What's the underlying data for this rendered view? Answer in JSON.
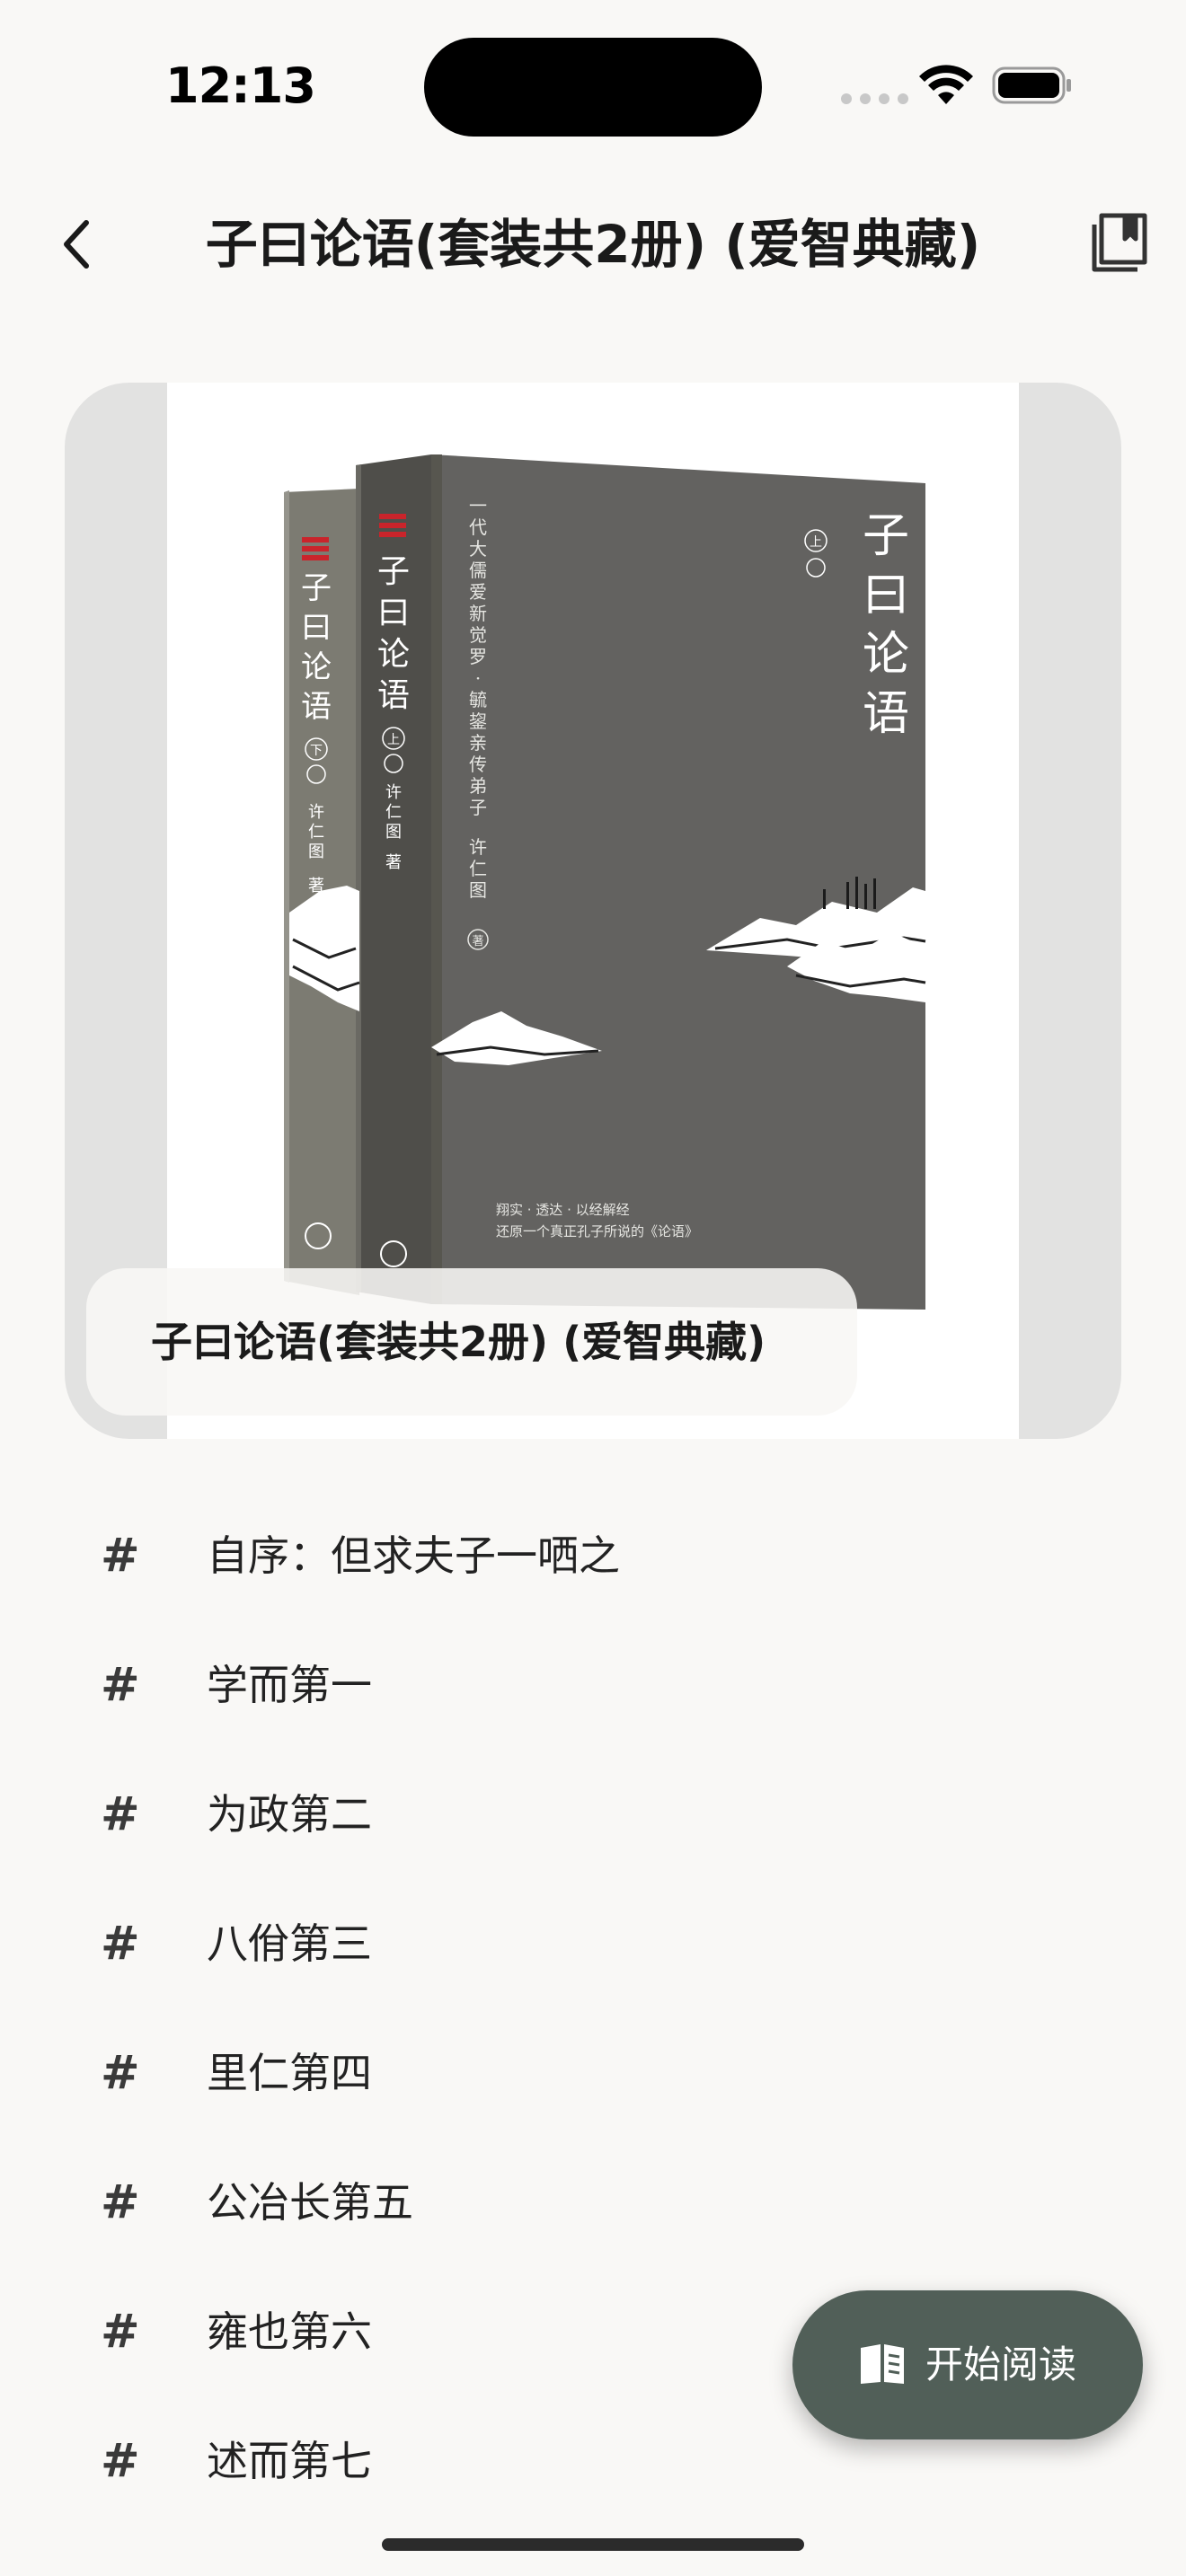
{
  "status_bar": {
    "time": "12:13"
  },
  "header": {
    "title": "子曰论语(套装共2册) (爱智典藏)",
    "back_icon": "chevron-left-icon",
    "bookshelf_icon": "bookshelf-icon"
  },
  "cover": {
    "caption": "子曰论语(套装共2册) (爱智典藏)",
    "front_title": [
      "子",
      "曰",
      "论",
      "语"
    ],
    "front_volume": "上",
    "front_tagline": "一代大儒爱新觉罗·毓鋆亲传弟子",
    "front_author": "许仁图",
    "front_bottom_line1": "翔实 · 透达 · 以经解经",
    "front_bottom_line2": "还原一个真正孔子所说的《论语》",
    "spine_title": [
      "子",
      "曰",
      "论",
      "语"
    ],
    "spine_volume_1": "上",
    "spine_volume_2": "下",
    "spine_author": "许仁图",
    "author_mark": "著"
  },
  "chapters": [
    {
      "hash": "#",
      "label": "自序：但求夫子一哂之"
    },
    {
      "hash": "#",
      "label": "学而第一"
    },
    {
      "hash": "#",
      "label": "为政第二"
    },
    {
      "hash": "#",
      "label": "八佾第三"
    },
    {
      "hash": "#",
      "label": "里仁第四"
    },
    {
      "hash": "#",
      "label": "公冶长第五"
    },
    {
      "hash": "#",
      "label": "雍也第六"
    },
    {
      "hash": "#",
      "label": "述而第七"
    }
  ],
  "fab": {
    "label": "开始阅读",
    "icon": "book-open-icon",
    "color": "#515f58"
  },
  "colors": {
    "background": "#f9f8f6",
    "cover_card": "#e2e2e1",
    "book_cover": "#636260"
  }
}
